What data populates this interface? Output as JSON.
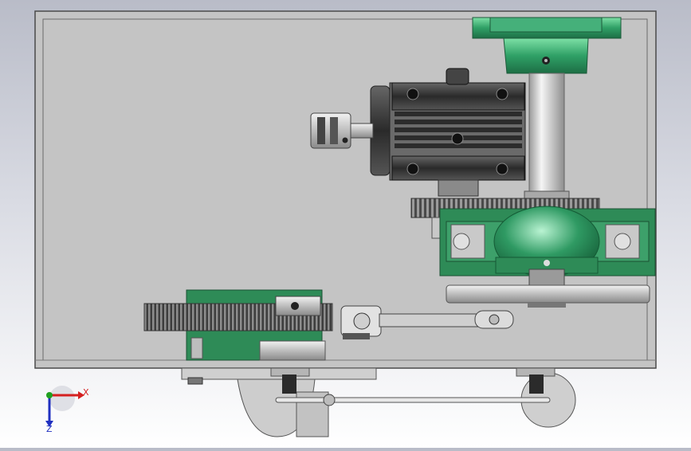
{
  "viewport": {
    "background_top": "#b9bcc8",
    "background_bottom": "#ffffff"
  },
  "colors": {
    "plate": "#c5c5c5",
    "plate_edge": "#555555",
    "green": "#2e8b57",
    "green_light": "#6fcf97",
    "dark_metal": "#3a3a3a",
    "steel": "#d6d6d6",
    "axis_x": "#d42020",
    "axis_y": "#20a020",
    "axis_z": "#2030c0"
  },
  "triad": {
    "x_label": "X",
    "z_label": "Z"
  },
  "parts": [
    "base-plate",
    "top-bearing-block",
    "vertical-shaft",
    "gear-motor",
    "jaw-coupling",
    "spur-gear",
    "pillow-block",
    "rack-gear",
    "pinion",
    "crank-arm",
    "connecting-rod",
    "support-feet",
    "tie-rod"
  ]
}
